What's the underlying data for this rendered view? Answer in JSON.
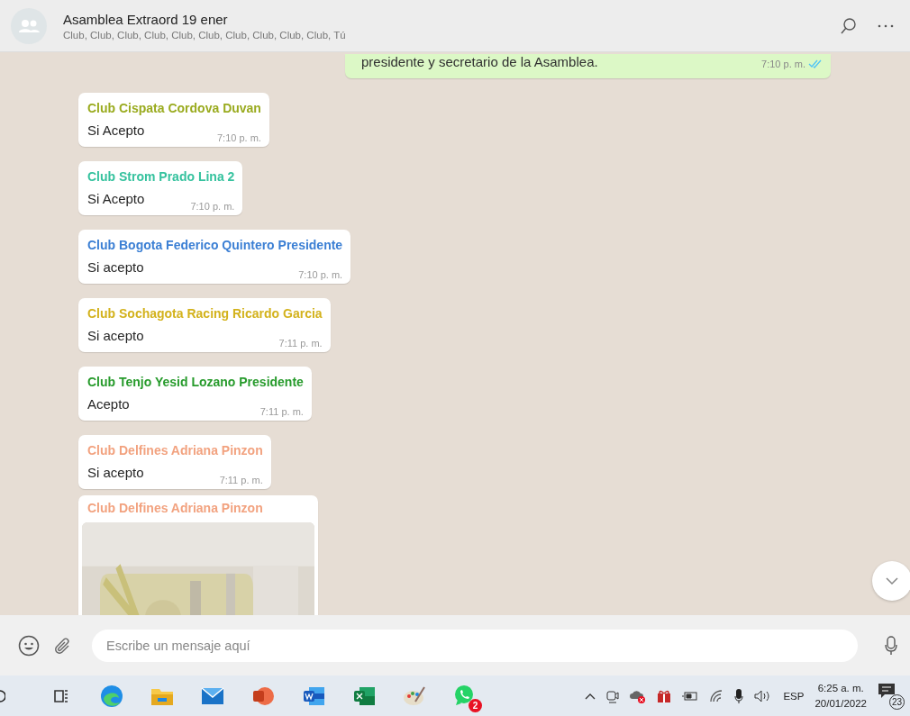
{
  "header": {
    "title": "Asamblea Extraord 19 ener",
    "participants": "Club, Club, Club, Club, Club, Club, Club, Club, Club, Club, Tú"
  },
  "messages": [
    {
      "kind": "outgoing",
      "text": "presidente y secretario de la Asamblea.",
      "time": "7:10 p. m.",
      "read": true
    },
    {
      "kind": "text",
      "sender": "Club Cispata Cordova Duvan",
      "color": "#9aab1f",
      "text": "Si Acepto",
      "time": "7:10 p. m."
    },
    {
      "kind": "text",
      "sender": "Club Strom Prado Lina 2",
      "color": "#35c29e",
      "text": "Si Acepto",
      "time": "7:10 p. m."
    },
    {
      "kind": "text",
      "sender": "Club Bogota Federico Quintero Presidente",
      "color": "#3b7fd4",
      "text": "Si acepto",
      "time": "7:10 p. m."
    },
    {
      "kind": "text",
      "sender": "Club Sochagota Racing Ricardo Garcia",
      "color": "#d3b21c",
      "text": "Si acepto",
      "time": "7:11 p. m."
    },
    {
      "kind": "text",
      "sender": "Club Tenjo Yesid Lozano Presidente",
      "color": "#279b2c",
      "text": "Acepto",
      "time": "7:11 p. m."
    },
    {
      "kind": "text",
      "sender": "Club Delfines Adriana Pinzon",
      "color": "#f2a27f",
      "text": "Si acepto",
      "time": "7:11 p. m."
    },
    {
      "sender": "Club Delfines Adriana Pinzon",
      "color": "#f2a27f"
    }
  ],
  "composer": {
    "placeholder": "Escribe un mensaje aquí"
  },
  "taskbar": {
    "apps": [
      {
        "kind": "taskview"
      },
      {
        "kind": "edge"
      },
      {
        "kind": "explorer"
      },
      {
        "kind": "mail"
      },
      {
        "kind": "powerpoint"
      },
      {
        "kind": "word"
      },
      {
        "kind": "excel"
      },
      {
        "kind": "paint"
      },
      {
        "kind": "whatsapp",
        "badge": "2"
      }
    ],
    "language": "ESP",
    "time": "6:25 a. m.",
    "date": "20/01/2022",
    "notifications": "23"
  }
}
